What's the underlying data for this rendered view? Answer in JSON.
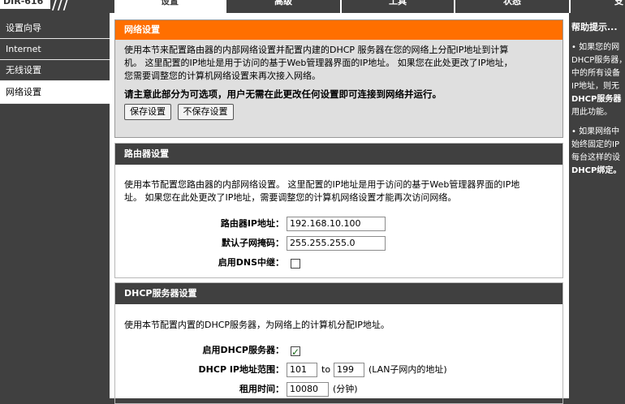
{
  "header": {
    "model": "DIR-616",
    "slashes": "///",
    "tabs": [
      {
        "label": "设置",
        "active": true
      },
      {
        "label": "高级",
        "active": false
      },
      {
        "label": "工具",
        "active": false
      },
      {
        "label": "状态",
        "active": false
      },
      {
        "label": "支",
        "active": false
      }
    ]
  },
  "sidebar": {
    "items": [
      {
        "label": "设置向导",
        "active": false
      },
      {
        "label": "Internet",
        "active": false
      },
      {
        "label": "无线设置",
        "active": false
      },
      {
        "label": "网络设置",
        "active": true
      }
    ]
  },
  "intro": {
    "title": "网络设置",
    "line1": "使用本节来配置路由器的内部网络设置并配置内建的DHCP 服务器在您的网络上分配IP地址到计算",
    "line2": "机。 这里配置的IP地址是用于访问的基于Web管理器界面的IP地址。 如果您在此处更改了IP地址，",
    "line3": "您需要调整您的计算机网络设置来再次接入网络。",
    "note": "请主意此部分为可选项，用户无需在此更改任何设置即可连接到网络并运行。",
    "save_label": "保存设置",
    "nosave_label": "不保存设置"
  },
  "router": {
    "title": "路由器设置",
    "line1": "使用本节配置您路由器的内部网络设置。 这里配置的IP地址是用于访问的基于Web管理器界面的IP地",
    "line2": "址。 如果您在此处更改了IP地址，需要调整您的计算机网络设置才能再次访问网络。",
    "ip_label": "路由器IP地址：",
    "ip_value": "192.168.10.100",
    "mask_label": "默认子网掩码：",
    "mask_value": "255.255.255.0",
    "dns_label": "启用DNS中继：",
    "dns_checked": false
  },
  "dhcp": {
    "title": "DHCP服务器设置",
    "line1": "使用本节配置内置的DHCP服务器，为网络上的计算机分配IP地址。",
    "enable_label": "启用DHCP服务器：",
    "enable_checked": true,
    "range_label": "DHCP IP地址范围：",
    "range_start": "101",
    "range_to": "to",
    "range_end": "199",
    "range_note": "(LAN子网内的地址)",
    "lease_label": "租用时间：",
    "lease_value": "10080",
    "lease_unit": "(分钟)"
  },
  "help": {
    "title": "帮助提示...",
    "bullet1_lines": [
      "• 如果您的网",
      "DHCP服务器，",
      "中的所有设备",
      "IP地址，则无"
    ],
    "bullet1_bold": "DHCP服务器",
    "bullet1_tail": "用此功能。",
    "bullet2_lines": [
      "• 如果网络中",
      "始终固定的IP",
      "每台这样的设"
    ],
    "bullet2_bold": "DHCP绑定。"
  }
}
